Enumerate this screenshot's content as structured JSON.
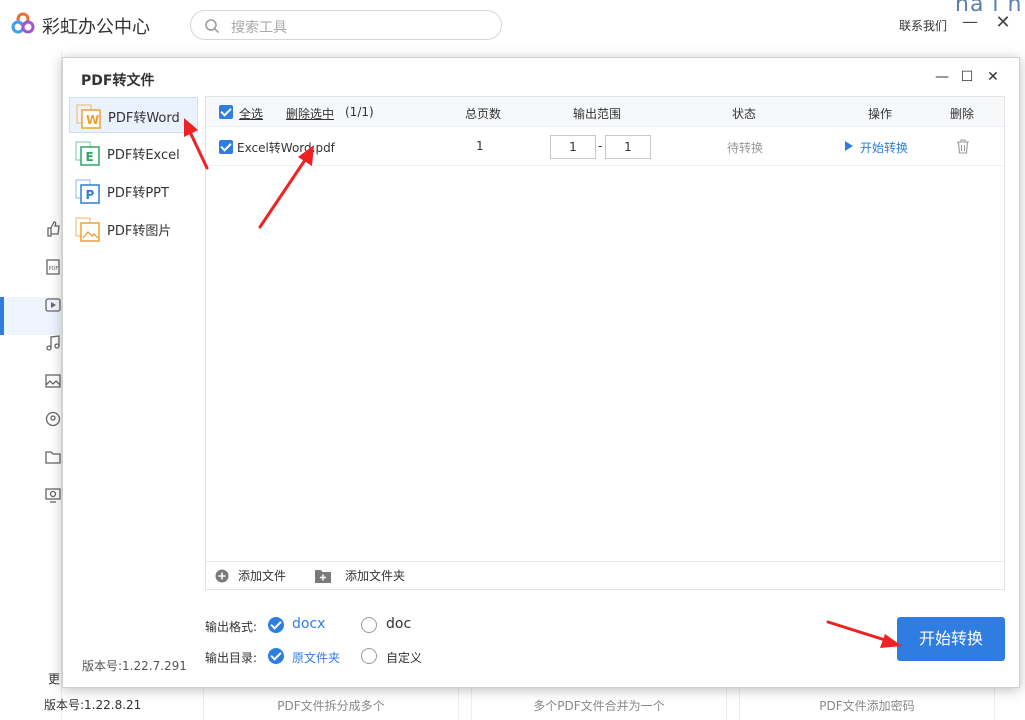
{
  "app": {
    "title": "彩虹办公中心",
    "search_placeholder": "搜索工具",
    "contact": "联系我们",
    "corner_text": "na l n",
    "version": "版本号:1.22.8.21",
    "more_label": "更",
    "nav_icons": [
      "thumbs-up-icon",
      "pdf-icon",
      "video-icon",
      "music-icon",
      "image-icon",
      "location-icon",
      "folder-icon",
      "monitor-icon"
    ]
  },
  "bg_cards": [
    "PDF文件拆分成多个",
    "多个PDF文件合并为一个",
    "PDF文件添加密码"
  ],
  "dialog": {
    "title": "PDF转文件",
    "version": "版本号:1.22.7.291",
    "sidebar": [
      {
        "label": "PDF转Word",
        "letter": "W",
        "color": "#f0a030",
        "active": true
      },
      {
        "label": "PDF转Excel",
        "letter": "E",
        "color": "#2aa862",
        "active": false
      },
      {
        "label": "PDF转PPT",
        "letter": "P",
        "color": "#2f7de1",
        "active": false
      },
      {
        "label": "PDF转图片",
        "letter": "",
        "color": "#f0a030",
        "active": false
      }
    ],
    "table": {
      "select_all": "全选",
      "delete_selected": "删除选中",
      "count": "(1/1)",
      "headers": {
        "pages": "总页数",
        "range": "输出范围",
        "status": "状态",
        "action": "操作",
        "delete": "删除"
      },
      "rows": [
        {
          "name": "Excel转Word.pdf",
          "pages": "1",
          "range_from": "1",
          "range_sep": "-",
          "range_to": "1",
          "status": "待转换",
          "action": "开始转换"
        }
      ],
      "add_file": "添加文件",
      "add_folder": "添加文件夹"
    },
    "options": {
      "format_label": "输出格式:",
      "formats": [
        "docx",
        "doc"
      ],
      "format_selected": "docx",
      "dir_label": "输出目录:",
      "dirs": [
        "原文件夹",
        "自定义"
      ],
      "dir_selected": "原文件夹"
    },
    "start_button": "开始转换"
  },
  "colors": {
    "accent": "#2f7de1",
    "annotation_arrow": "#ee2222"
  }
}
